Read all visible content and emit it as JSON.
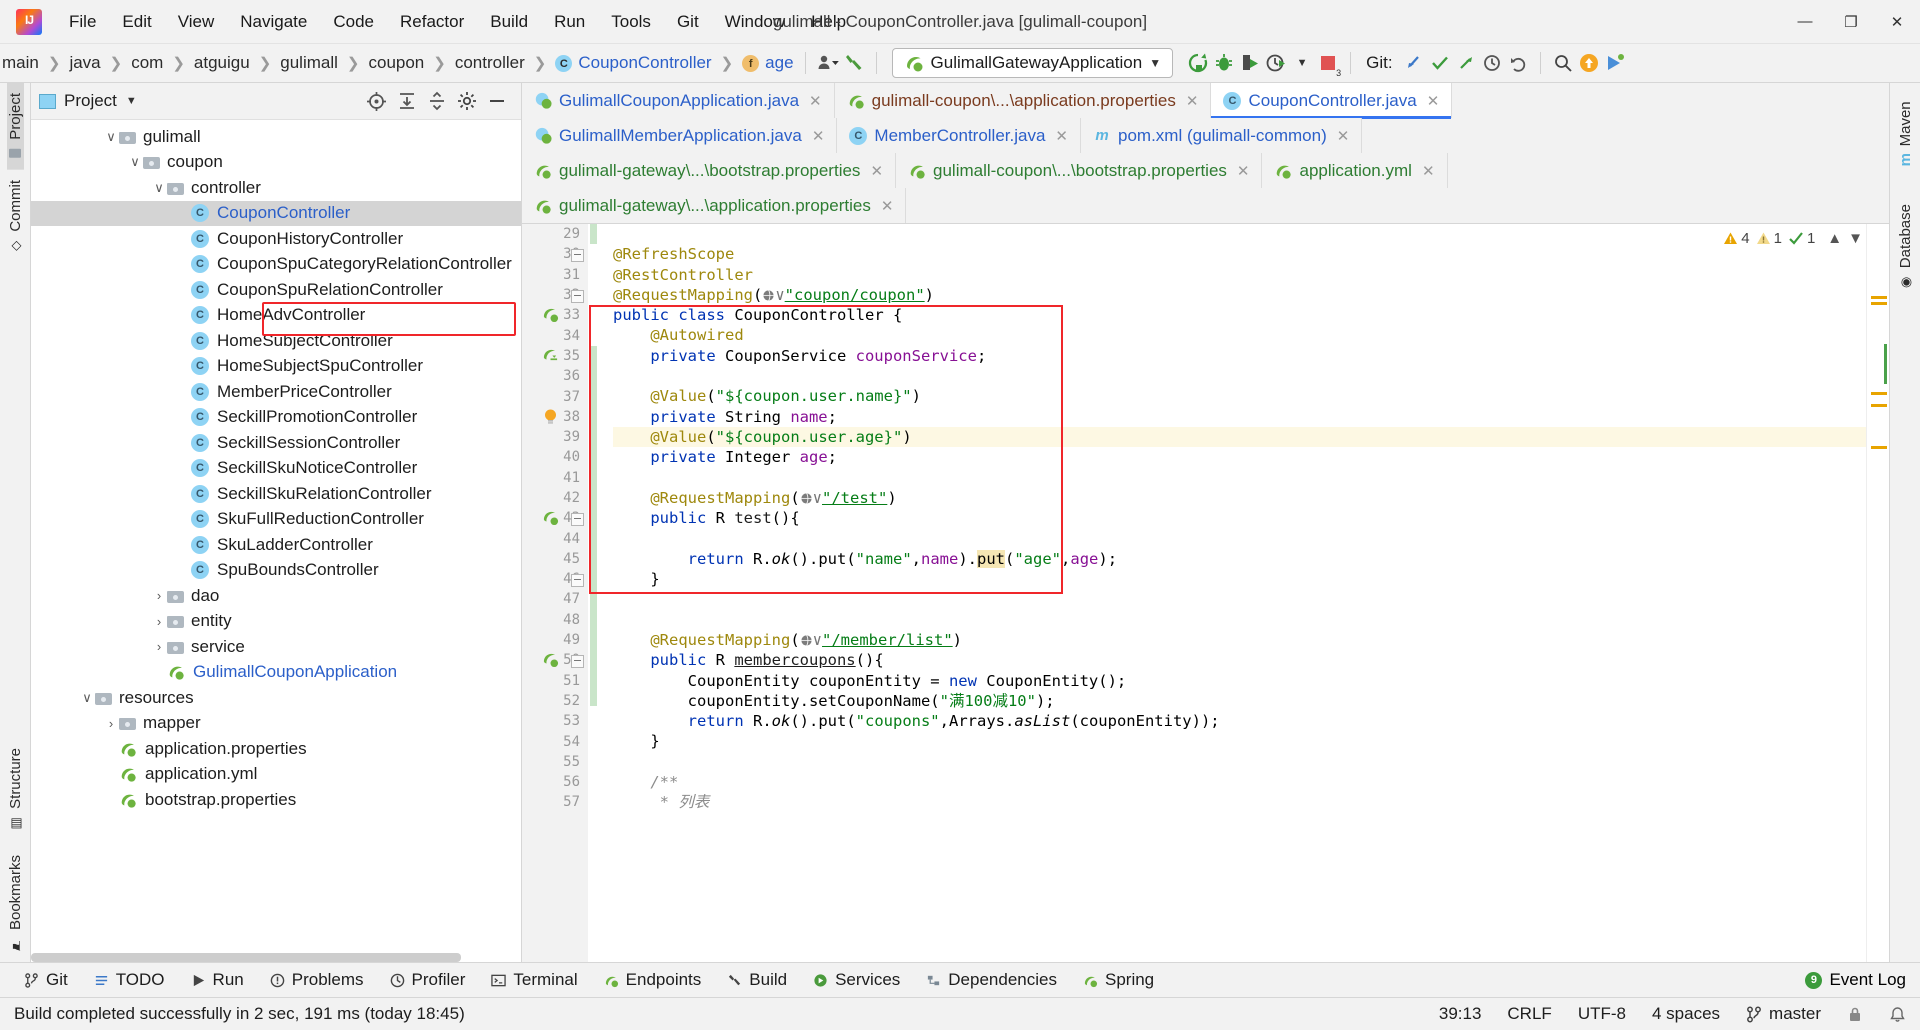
{
  "window": {
    "title": "gulimall - CouponController.java [gulimall-coupon]",
    "logo_text": "IJ",
    "controls": {
      "minimize": "—",
      "maximize": "❐",
      "close": "✕"
    }
  },
  "menubar": [
    "File",
    "Edit",
    "View",
    "Navigate",
    "Code",
    "Refactor",
    "Build",
    "Run",
    "Tools",
    "Git",
    "Window",
    "Help"
  ],
  "navbar": {
    "breadcrumbs": [
      "main",
      "java",
      "com",
      "atguigu",
      "gulimall",
      "coupon",
      "controller",
      "CouponController",
      "age"
    ],
    "breadcrumb_class_badge": "C",
    "breadcrumb_field_badge": "f",
    "run_configuration": "GulimallGatewayApplication",
    "git_label": "Git:",
    "stop_badge": "3"
  },
  "project_panel": {
    "header_title": "Project",
    "tree": [
      {
        "indent": 3,
        "twist": "∨",
        "icon": "folder",
        "label": "gulimall",
        "style": "plain"
      },
      {
        "indent": 4,
        "twist": "∨",
        "icon": "folder",
        "label": "coupon",
        "style": "plain"
      },
      {
        "indent": 5,
        "twist": "∨",
        "icon": "folder",
        "label": "controller",
        "style": "plain"
      },
      {
        "indent": 6,
        "twist": "",
        "icon": "class",
        "label": "CouponController",
        "style": "blue",
        "selected": true
      },
      {
        "indent": 6,
        "twist": "",
        "icon": "class",
        "label": "CouponHistoryController",
        "style": "plain"
      },
      {
        "indent": 6,
        "twist": "",
        "icon": "class",
        "label": "CouponSpuCategoryRelationController",
        "style": "plain"
      },
      {
        "indent": 6,
        "twist": "",
        "icon": "class",
        "label": "CouponSpuRelationController",
        "style": "plain"
      },
      {
        "indent": 6,
        "twist": "",
        "icon": "class",
        "label": "HomeAdvController",
        "style": "plain"
      },
      {
        "indent": 6,
        "twist": "",
        "icon": "class",
        "label": "HomeSubjectController",
        "style": "plain"
      },
      {
        "indent": 6,
        "twist": "",
        "icon": "class",
        "label": "HomeSubjectSpuController",
        "style": "plain"
      },
      {
        "indent": 6,
        "twist": "",
        "icon": "class",
        "label": "MemberPriceController",
        "style": "plain"
      },
      {
        "indent": 6,
        "twist": "",
        "icon": "class",
        "label": "SeckillPromotionController",
        "style": "plain"
      },
      {
        "indent": 6,
        "twist": "",
        "icon": "class",
        "label": "SeckillSessionController",
        "style": "plain"
      },
      {
        "indent": 6,
        "twist": "",
        "icon": "class",
        "label": "SeckillSkuNoticeController",
        "style": "plain"
      },
      {
        "indent": 6,
        "twist": "",
        "icon": "class",
        "label": "SeckillSkuRelationController",
        "style": "plain"
      },
      {
        "indent": 6,
        "twist": "",
        "icon": "class",
        "label": "SkuFullReductionController",
        "style": "plain"
      },
      {
        "indent": 6,
        "twist": "",
        "icon": "class",
        "label": "SkuLadderController",
        "style": "plain"
      },
      {
        "indent": 6,
        "twist": "",
        "icon": "class",
        "label": "SpuBoundsController",
        "style": "plain"
      },
      {
        "indent": 5,
        "twist": "›",
        "icon": "folder",
        "label": "dao",
        "style": "plain"
      },
      {
        "indent": 5,
        "twist": "›",
        "icon": "folder",
        "label": "entity",
        "style": "plain"
      },
      {
        "indent": 5,
        "twist": "›",
        "icon": "folder",
        "label": "service",
        "style": "plain"
      },
      {
        "indent": 5,
        "twist": "",
        "icon": "spring",
        "label": "GulimallCouponApplication",
        "style": "blue"
      },
      {
        "indent": 2,
        "twist": "∨",
        "icon": "folder",
        "label": "resources",
        "style": "plain"
      },
      {
        "indent": 3,
        "twist": "›",
        "icon": "folder",
        "label": "mapper",
        "style": "plain"
      },
      {
        "indent": 3,
        "twist": "",
        "icon": "spring",
        "label": "application.properties",
        "style": "plain"
      },
      {
        "indent": 3,
        "twist": "",
        "icon": "spring",
        "label": "application.yml",
        "style": "plain"
      },
      {
        "indent": 3,
        "twist": "",
        "icon": "spring",
        "label": "bootstrap.properties",
        "style": "plain"
      }
    ]
  },
  "left_strip": {
    "tabs": [
      "Project",
      "Commit",
      "Structure",
      "Bookmarks"
    ]
  },
  "right_strip": {
    "tabs": [
      "Maven",
      "Database"
    ]
  },
  "editor_tabs": {
    "row1": [
      {
        "label": "GulimallCouponApplication.java",
        "icon": "spring-class",
        "color": "blue",
        "active": false
      },
      {
        "label": "gulimall-coupon\\...\\application.properties",
        "icon": "spring",
        "color": "maroon",
        "active": false
      },
      {
        "label": "CouponController.java",
        "icon": "class",
        "color": "blue",
        "active": true
      }
    ],
    "row2": [
      {
        "label": "GulimallMemberApplication.java",
        "icon": "spring-class",
        "color": "blue",
        "active": false
      },
      {
        "label": "MemberController.java",
        "icon": "class",
        "color": "blue",
        "active": false
      },
      {
        "label": "pom.xml (gulimall-common)",
        "icon": "maven",
        "color": "blue",
        "active": false
      }
    ],
    "row3": [
      {
        "label": "gulimall-gateway\\...\\bootstrap.properties",
        "icon": "spring",
        "color": "green",
        "active": false
      },
      {
        "label": "gulimall-coupon\\...\\bootstrap.properties",
        "icon": "spring",
        "color": "green",
        "active": false
      },
      {
        "label": "application.yml",
        "icon": "spring",
        "color": "green",
        "active": false
      }
    ],
    "row4": [
      {
        "label": "gulimall-gateway\\...\\application.properties",
        "icon": "spring",
        "color": "green",
        "active": false
      }
    ],
    "close_glyph": "✕"
  },
  "inspection": {
    "warnings": "4",
    "weak_warnings": "1",
    "checks": "1"
  },
  "code": {
    "first_line_number": 29,
    "highlight_line": 39,
    "lines": [
      {
        "n": 29,
        "html": ""
      },
      {
        "n": 30,
        "html": "<span class='ann'>@RefreshScope</span>"
      },
      {
        "n": 31,
        "html": "<span class='ann'>@RestController</span>"
      },
      {
        "n": 32,
        "html": "<span class='ann'>@RequestMapping</span>(<span class='gico'></span><span class='str ul'>\"coupon/coupon\"</span>)"
      },
      {
        "n": 33,
        "html": "<span class='k'>public</span> <span class='k'>class</span> CouponController {"
      },
      {
        "n": 34,
        "html": "    <span class='ann'>@Autowired</span>"
      },
      {
        "n": 35,
        "html": "    <span class='k'>private</span> CouponService <span class='fld'>couponService</span>;"
      },
      {
        "n": 36,
        "html": ""
      },
      {
        "n": 37,
        "html": "    <span class='ann'>@Value</span>(<span class='str'>\"${coupon.user.name}\"</span>)"
      },
      {
        "n": 38,
        "html": "    <span class='k'>private</span> String <span class='fld'>name</span>;"
      },
      {
        "n": 39,
        "html": "    <span class='ann'>@Value</span>(<span class='str'>\"${coupon.user.age}\"</span>)"
      },
      {
        "n": 40,
        "html": "    <span class='k'>private</span> Integer <span class='fld'>age</span>;"
      },
      {
        "n": 41,
        "html": ""
      },
      {
        "n": 42,
        "html": "    <span class='ann'>@RequestMapping</span>(<span class='gico'></span><span class='str ul'>\"/test\"</span>)"
      },
      {
        "n": 43,
        "html": "    <span class='k'>public</span> R <span class='typ'>test</span>(){"
      },
      {
        "n": 44,
        "html": ""
      },
      {
        "n": 45,
        "html": "        <span class='k'>return</span> R.<span class='ital'>ok</span>().put(<span class='str'>\"name\"</span>,<span class='fld'>name</span>).<span class='hlput'>put</span>(<span class='str'>\"age\"</span>,<span class='fld'>age</span>);"
      },
      {
        "n": 46,
        "html": "    }"
      },
      {
        "n": 47,
        "html": ""
      },
      {
        "n": 48,
        "html": ""
      },
      {
        "n": 49,
        "html": "    <span class='ann'>@RequestMapping</span>(<span class='gico'></span><span class='str ul'>\"/member/list\"</span>)"
      },
      {
        "n": 50,
        "html": "    <span class='k'>public</span> R <span class='typ ul'>membercoupons</span>(){"
      },
      {
        "n": 51,
        "html": "        CouponEntity couponEntity = <span class='k'>new</span> CouponEntity();"
      },
      {
        "n": 52,
        "html": "        couponEntity.setCouponName(<span class='str'>\"满100减10\"</span>);"
      },
      {
        "n": 53,
        "html": "        <span class='k'>return</span> R.<span class='ital'>ok</span>().put(<span class='str'>\"coupons\"</span>,Arrays.<span class='ital'>asList</span>(couponEntity));"
      },
      {
        "n": 54,
        "html": "    }"
      },
      {
        "n": 55,
        "html": ""
      },
      {
        "n": 56,
        "html": "    <span class='cmt'>/**</span>"
      },
      {
        "n": 57,
        "html": "     <span class='cmt'>* 列表</span>"
      }
    ]
  },
  "bottom_bar": {
    "items": [
      "Git",
      "TODO",
      "Run",
      "Problems",
      "Profiler",
      "Terminal",
      "Endpoints",
      "Build",
      "Services",
      "Dependencies",
      "Spring"
    ],
    "event_log": "Event Log",
    "event_log_count": "9"
  },
  "status_bar": {
    "message": "Build completed successfully in 2 sec, 191 ms (today 18:45)",
    "caret": "39:13",
    "line_separator": "CRLF",
    "encoding": "UTF-8",
    "indent": "4 spaces",
    "branch": "master"
  },
  "colors": {
    "accent": "#3574f0",
    "highlight_box": "#f0262a",
    "keyword": "#0033b3",
    "string": "#067d17",
    "annotation": "#9e880d",
    "field": "#871094",
    "selection": "#d4d4d4"
  }
}
